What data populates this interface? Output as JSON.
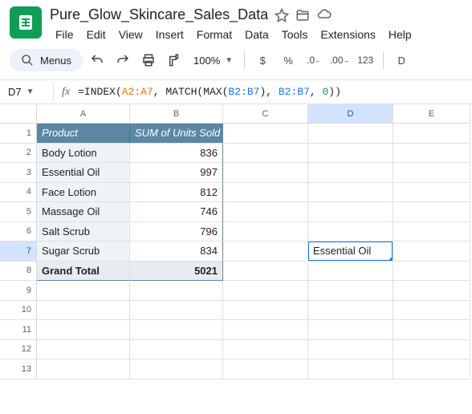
{
  "doc": {
    "title": "Pure_Glow_Skincare_Sales_Data"
  },
  "menu": {
    "file": "File",
    "edit": "Edit",
    "view": "View",
    "insert": "Insert",
    "format": "Format",
    "data": "Data",
    "tools": "Tools",
    "extensions": "Extensions",
    "help": "Help"
  },
  "toolbar": {
    "search": "Menus",
    "zoom": "100%",
    "numfmt": "123"
  },
  "namebox": "D7",
  "formula_parts": {
    "eq": "=",
    "fn1": "INDEX",
    "open": "(",
    "a": "A2:A7",
    "c": ", ",
    "fn2": "MATCH",
    "fn3": "MAX",
    "b": "B2:B7",
    "zero": "0",
    "close": ")"
  },
  "cols": [
    "A",
    "B",
    "C",
    "D",
    "E"
  ],
  "rows": [
    "1",
    "2",
    "3",
    "4",
    "5",
    "6",
    "7",
    "8",
    "9",
    "10",
    "11",
    "12",
    "13"
  ],
  "pivot": {
    "head_a": "Product",
    "head_b": "SUM of Units Sold",
    "rows": [
      {
        "a": "Body Lotion",
        "b": "836"
      },
      {
        "a": "Essential Oil",
        "b": "997"
      },
      {
        "a": "Face Lotion",
        "b": "812"
      },
      {
        "a": "Massage Oil",
        "b": "746"
      },
      {
        "a": "Salt Scrub",
        "b": "796"
      },
      {
        "a": "Sugar Scrub",
        "b": "834"
      }
    ],
    "total_label": "Grand Total",
    "total_value": "5021"
  },
  "d7_value": "Essential Oil"
}
